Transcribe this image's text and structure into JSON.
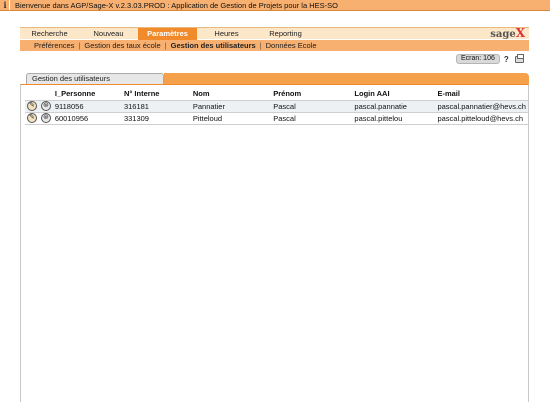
{
  "infobar": {
    "icon": "info-icon",
    "text": "Bienvenue dans AGP/Sage-X v.2.3.03.PROD : Application de Gestion de Projets pour la HES-SO"
  },
  "logo": {
    "text": "sage",
    "mark": "X"
  },
  "tabs": [
    {
      "label": "Recherche",
      "active": false
    },
    {
      "label": "Nouveau",
      "active": false
    },
    {
      "label": "Paramètres",
      "active": true
    },
    {
      "label": "Heures",
      "active": false
    },
    {
      "label": "Reporting",
      "active": false
    }
  ],
  "subnav": [
    {
      "label": "Préférences",
      "active": false
    },
    {
      "label": "Gestion des taux école",
      "active": false
    },
    {
      "label": "Gestion des utilisateurs",
      "active": true
    },
    {
      "label": "Données Ecole",
      "active": false
    }
  ],
  "screen": {
    "label": "Ecran: 106",
    "help": "?",
    "print_icon": "printer-icon"
  },
  "section": {
    "title": "Gestion des utilisateurs"
  },
  "table": {
    "headers": [
      "I_Personne",
      "N° Interne",
      "Nom",
      "Prénom",
      "Login AAI",
      "E-mail"
    ],
    "rows": [
      [
        "9118056",
        "316181",
        "Pannatier",
        "Pascal",
        "pascal.pannatie",
        "pascal.pannatier@hevs.ch"
      ],
      [
        "60010956",
        "331309",
        "Pitteloud",
        "Pascal",
        "pascal.pittelou",
        "pascal.pitteloud@hevs.ch"
      ]
    ]
  },
  "colors": {
    "accent": "#f08a2a",
    "bar": "#f7b070",
    "tab_bg": "#fde7c9"
  }
}
